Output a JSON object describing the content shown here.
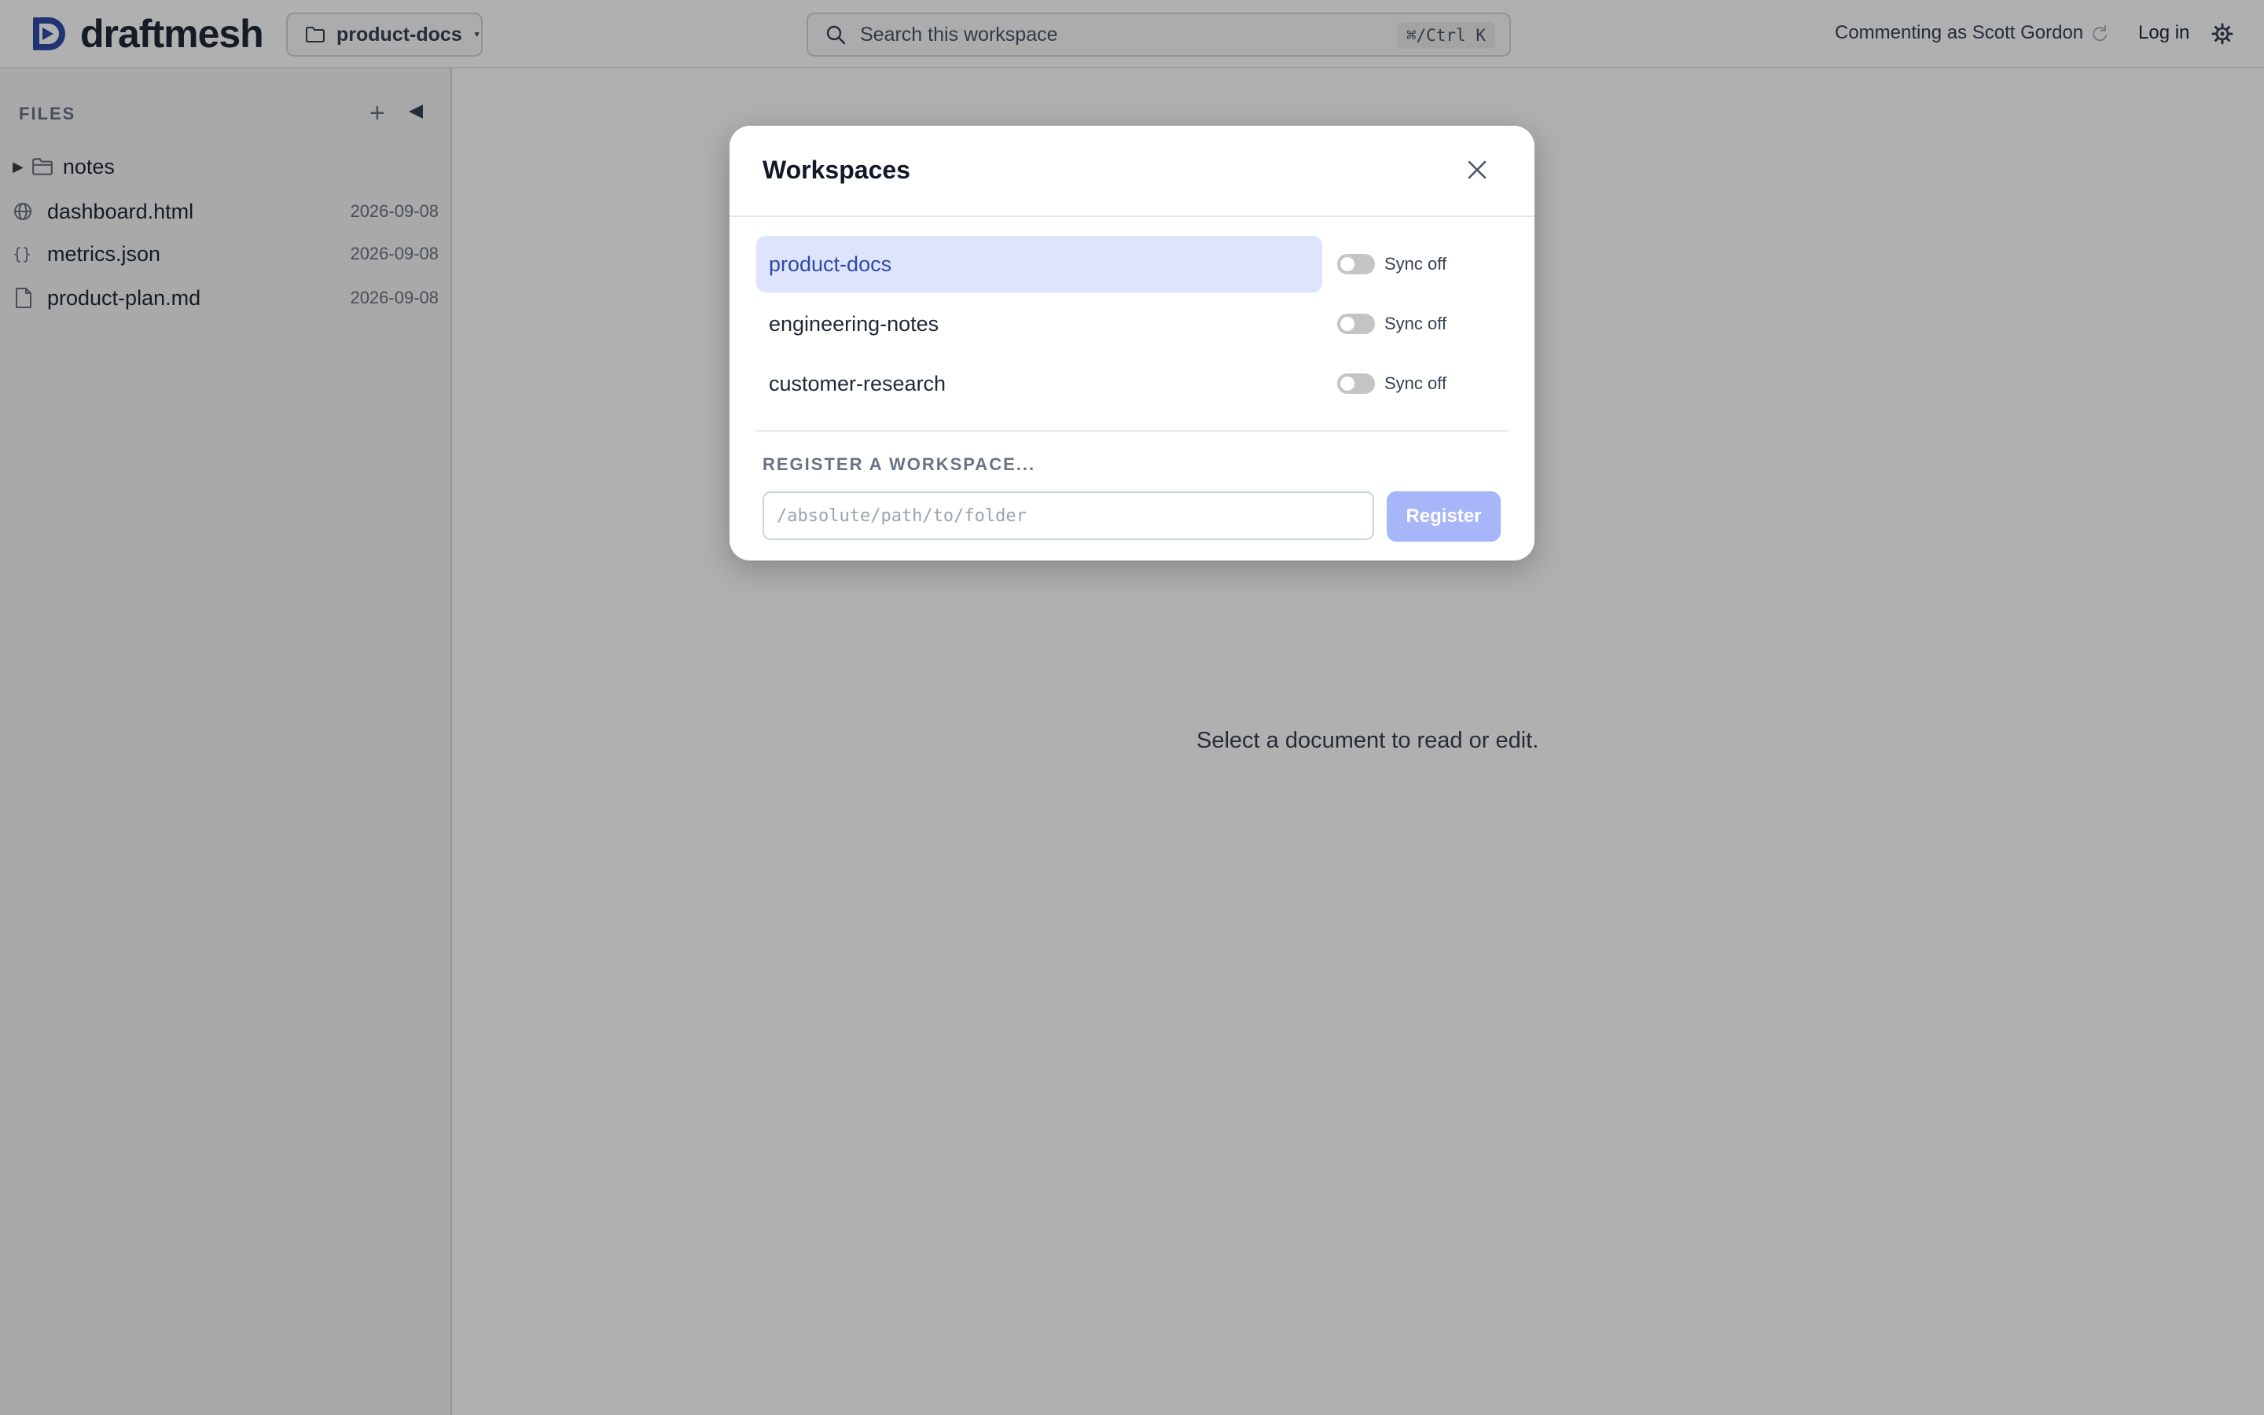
{
  "app": {
    "name": "draftmesh"
  },
  "header": {
    "workspace_label": "product-docs",
    "search_placeholder": "Search this workspace",
    "search_shortcut": "⌘/Ctrl K",
    "commenting_as": "Commenting as Scott Gordon",
    "login_label": "Log in"
  },
  "sidebar": {
    "heading": "FILES",
    "items": [
      {
        "name": "notes",
        "type": "folder",
        "date": ""
      },
      {
        "name": "dashboard.html",
        "type": "html",
        "date": "2026-09-08"
      },
      {
        "name": "metrics.json",
        "type": "json",
        "date": "2026-09-08"
      },
      {
        "name": "product-plan.md",
        "type": "md",
        "date": "2026-09-08"
      }
    ]
  },
  "main": {
    "empty_message": "Select a document to read or edit."
  },
  "modal": {
    "title": "Workspaces",
    "workspaces": [
      {
        "name": "product-docs",
        "sync_label": "Sync off",
        "active": true
      },
      {
        "name": "engineering-notes",
        "sync_label": "Sync off",
        "active": false
      },
      {
        "name": "customer-research",
        "sync_label": "Sync off",
        "active": false
      }
    ],
    "register_heading": "REGISTER A WORKSPACE...",
    "register_placeholder": "/absolute/path/to/folder",
    "register_button": "Register"
  },
  "colors": {
    "brand": "#2f4aa6",
    "active_row": "#dde4fb",
    "register_button": "#a7b6f8",
    "toggle_off": "#c4c4c4"
  },
  "icons": [
    "logo-mark-icon",
    "folder-icon",
    "search-icon",
    "refresh-icon",
    "gear-icon",
    "plus-icon",
    "collapse-icon",
    "globe-icon",
    "braces-icon",
    "file-icon",
    "close-icon"
  ]
}
